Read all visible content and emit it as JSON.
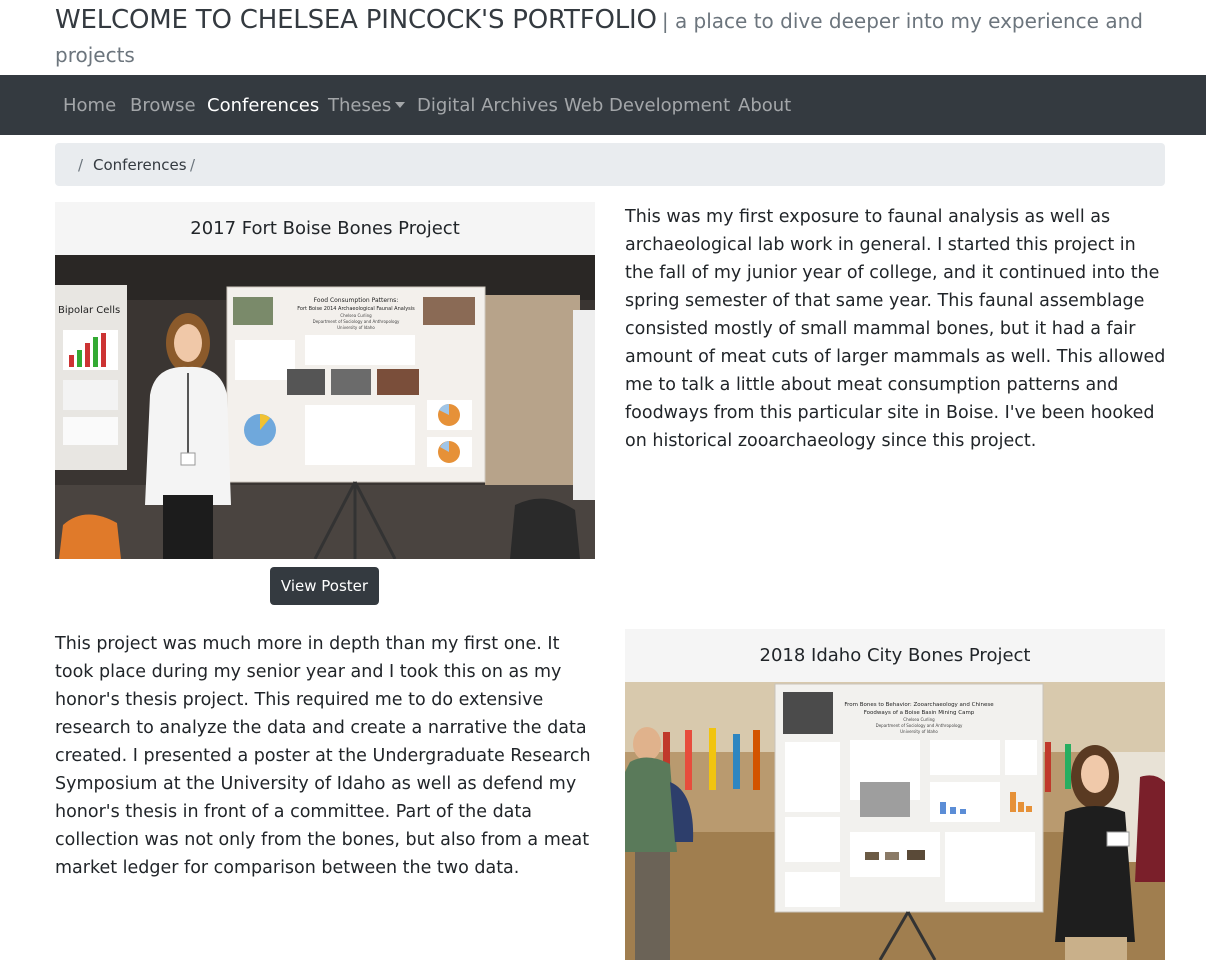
{
  "header": {
    "title": "WELCOME TO CHELSEA PINCOCK'S PORTFOLIO",
    "subtitle": "| a place to dive deeper into my experience and projects"
  },
  "nav": {
    "items": [
      {
        "label": "Home"
      },
      {
        "label": "Browse"
      },
      {
        "label": "Conferences"
      },
      {
        "label": "Theses"
      },
      {
        "label": "Digital Archives"
      },
      {
        "label": "Web Development"
      },
      {
        "label": "About"
      }
    ]
  },
  "breadcrumb": {
    "current": "Conferences"
  },
  "projects": [
    {
      "title": "2017 Fort Boise Bones Project",
      "button": "View Poster",
      "poster": {
        "title": "Food Consumption Patterns:",
        "subtitle": "Fort Boise 2014 Archaeological Faunal Analysis",
        "author": "Chelsea Curling",
        "dept": "Department of Sociology and Anthropology",
        "university": "University of Idaho"
      },
      "side_poster_title": "Bipolar Cells",
      "description": "This was my first exposure to faunal analysis as well as archaeological lab work in general. I started this project in the fall of my junior year of college, and it continued into the spring semester of that same year. This faunal assemblage consisted mostly of small mammal bones, but it had a fair amount of meat cuts of larger mammals as well. This allowed me to talk a little about meat consumption patterns and foodways from this particular site in Boise. I've been hooked on historical zooarchaeology since this project."
    },
    {
      "title": "2018 Idaho City Bones Project",
      "poster": {
        "title": "From Bones to Behavior: Zooarchaeology and Chinese",
        "subtitle": "Foodways of a Boise Basin Mining Camp",
        "author": "Chelsea Curling",
        "dept": "Department of Sociology and Anthropology",
        "university": "University of Idaho"
      },
      "description": "This project was much more in depth than my first one. It took place during my senior year and I took this on as my honor's thesis project. This required me to do extensive research to analyze the data and create a narrative the data created. I presented a poster at the Undergraduate Research Symposium at the University of Idaho as well as defend my honor's thesis in front of a committee. Part of the data collection was not only from the bones, but also from a meat market ledger for comparison between the two data."
    }
  ]
}
